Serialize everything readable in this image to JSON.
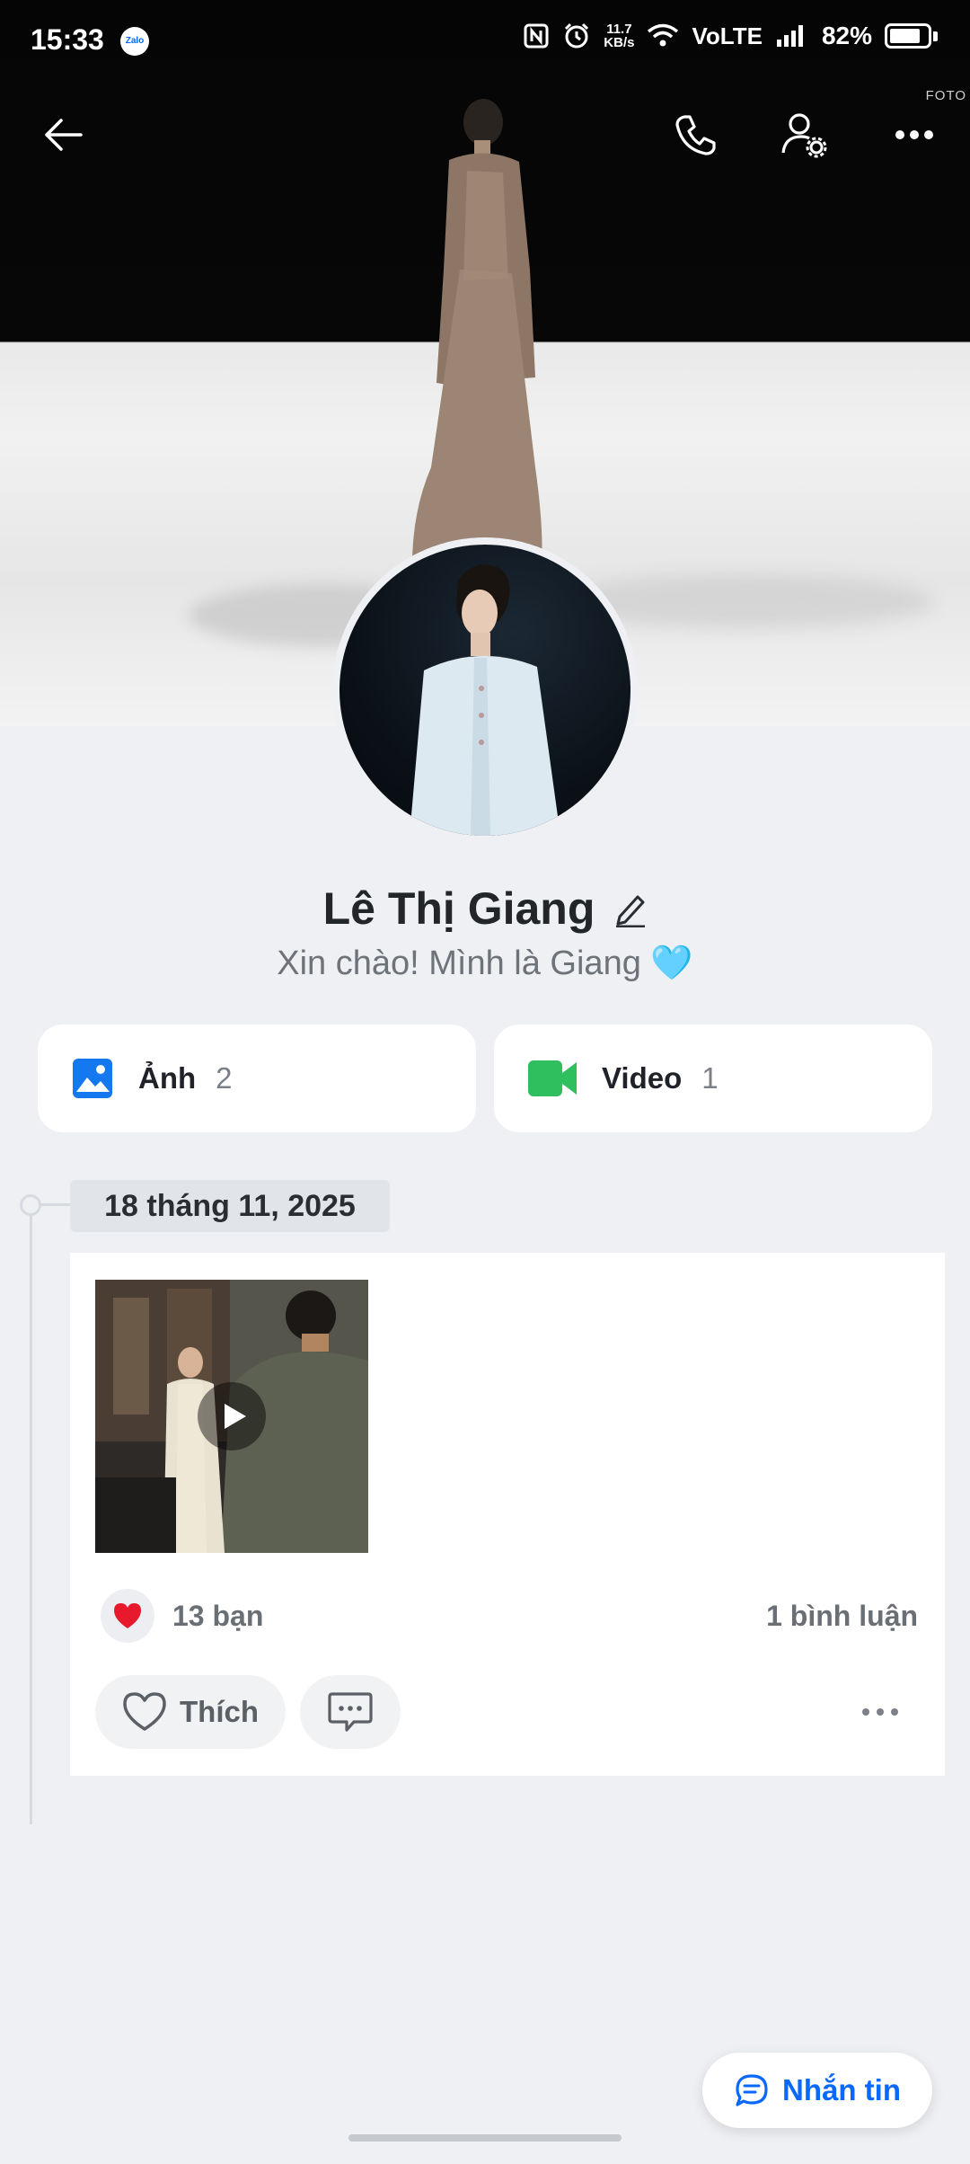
{
  "status_bar": {
    "time": "15:33",
    "app_badge": "Zalo",
    "net_speed_value": "11.7",
    "net_speed_unit": "KB/s",
    "network_label": "VoLTE",
    "battery_percent": "82%",
    "battery_level": 0.82
  },
  "cover": {
    "watermark": "FOTO"
  },
  "profile": {
    "name": "Lê Thị Giang",
    "bio": "Xin chào! Mình là Giang 🩵"
  },
  "media": {
    "photos_label": "Ảnh",
    "photos_count": "2",
    "videos_label": "Video",
    "videos_count": "1"
  },
  "timeline": {
    "date": "18 tháng 11, 2025",
    "post": {
      "reactions": "13 bạn",
      "comments": "1 bình luận",
      "like_label": "Thích"
    }
  },
  "actions": {
    "message_label": "Nhắn tin"
  },
  "colors": {
    "accent": "#0a68ff",
    "photo_icon": "#1478f0",
    "video_icon": "#2fbf5e",
    "heart": "#e8192c"
  }
}
